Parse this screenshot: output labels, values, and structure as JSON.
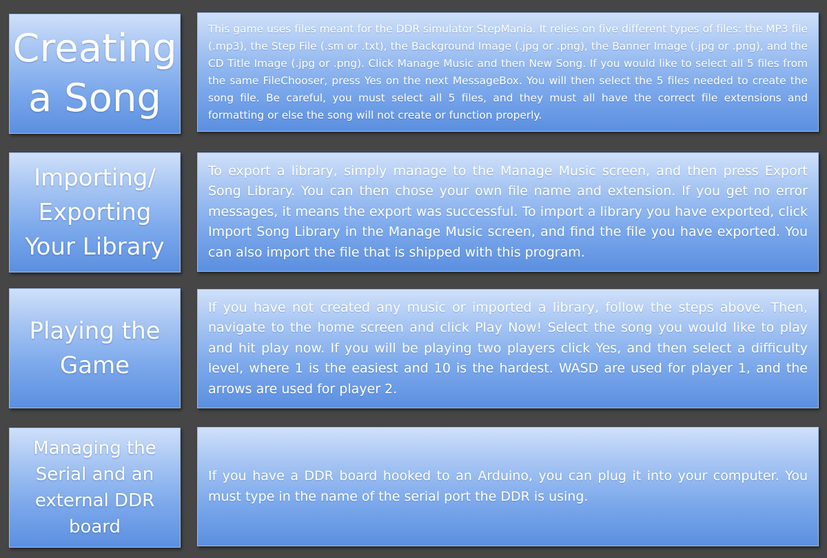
{
  "sections": [
    {
      "title": "Creating\na Song",
      "description": "This  game uses files meant for the DDR simulator StepMania. It relies on five different types of files: the MP3 file (.mp3), the Step File (.sm or .txt), the Background Image (.jpg or .png), the Banner Image (.jpg or .png), and the CD Title Image (.jpg or .png). Click Manage Music and then New Song. If you would like to select all 5 files from the same FileChooser, press Yes on the next MessageBox. You will then select the 5 files needed to create the song file. Be careful, you must select all 5 files, and they must all have the correct file extensions and formatting or else the song will not create or function properly."
    },
    {
      "title": "Importing/\nExporting\nYour Library",
      "description": "To export a library, simply manage to the Manage Music screen, and then press Export Song Library. You can then chose your own file name and extension. If you get no error messages, it means the export was successful. To import a library you have exported, click Import Song Library in the Manage Music screen, and find the file you have exported. You can also import the file that is shipped with this program."
    },
    {
      "title": "Playing the\nGame",
      "description": "If you have not created any music or imported a library, follow the steps above. Then, navigate to the home screen and click Play Now! Select the song you would like to play and hit play now. If you will be playing two players click Yes, and then select a difficulty level, where 1 is the easiest and 10 is the hardest. WASD are used for player 1, and the arrows are used for player 2."
    },
    {
      "title": "Managing the\nSerial and an\nexternal DDR\nboard",
      "description": "If you have a DDR board hooked to an Arduino, you can plug it into your computer. You must type in the name of the serial port the DDR is using."
    }
  ],
  "colors": {
    "background": "#464646",
    "box_gradient_top": "#cfe0fa",
    "box_gradient_bottom": "#5b8fe0",
    "text": "#ffffff"
  }
}
